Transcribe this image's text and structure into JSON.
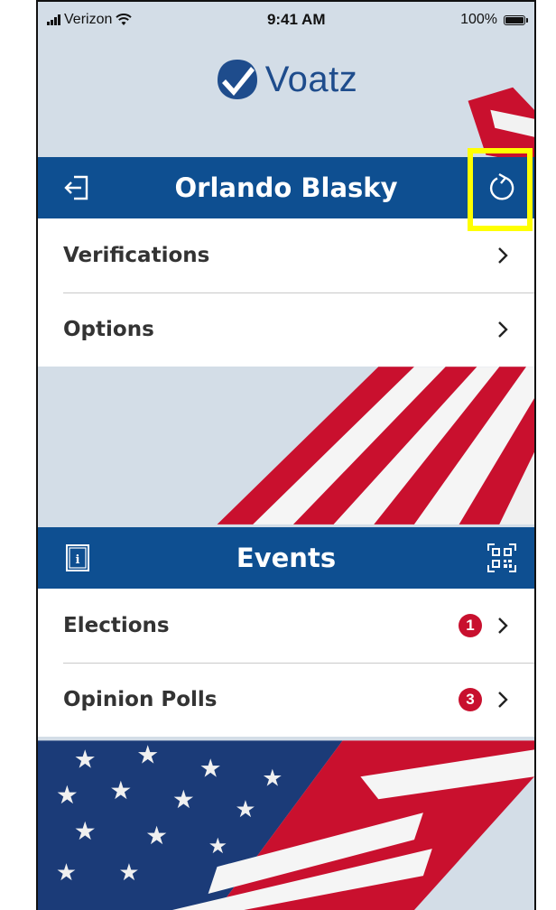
{
  "status_bar": {
    "carrier": "Verizon",
    "time": "9:41 AM",
    "battery": "100%"
  },
  "logo": {
    "text": "Voatz",
    "icon": "checkmark-shield-icon"
  },
  "profile_bar": {
    "name": "Orlando Blasky",
    "left_icon": "logout-icon",
    "right_icon": "refresh-icon"
  },
  "profile_menu": {
    "items": [
      {
        "label": "Verifications"
      },
      {
        "label": "Options"
      }
    ]
  },
  "events_bar": {
    "title": "Events",
    "left_icon": "info-icon",
    "right_icon": "qr-code-icon"
  },
  "events_menu": {
    "items": [
      {
        "label": "Elections",
        "badge": "1"
      },
      {
        "label": "Opinion Polls",
        "badge": "3"
      }
    ]
  },
  "colors": {
    "brand_blue": "#0e4f91",
    "logo_blue": "#1e4c8c",
    "badge_red": "#c8102e",
    "highlight_yellow": "#ffff00"
  }
}
